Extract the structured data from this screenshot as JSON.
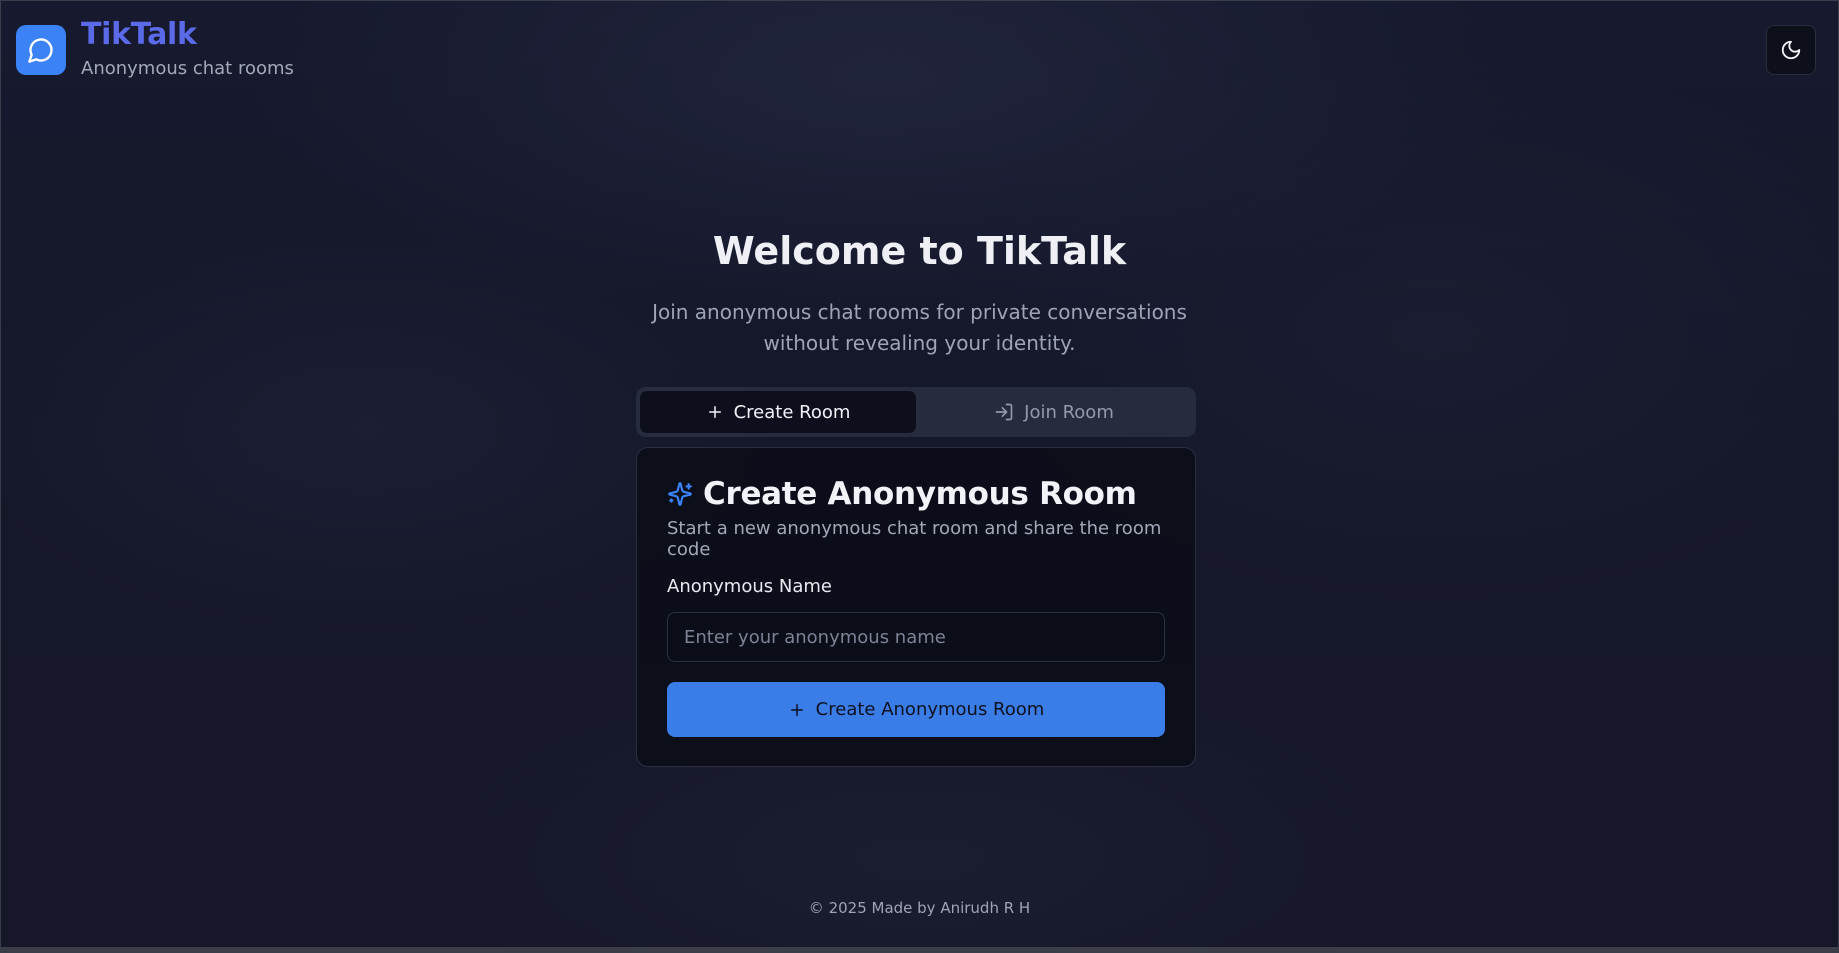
{
  "header": {
    "brand_title": "TikTalk",
    "brand_subtitle": "Anonymous chat rooms",
    "logo_icon": "message-circle-icon",
    "theme_toggle_icon": "moon-icon"
  },
  "hero": {
    "title": "Welcome to TikTalk",
    "subtitle": "Join anonymous chat rooms for private conversations without revealing your identity."
  },
  "tabs": [
    {
      "label": "Create Room",
      "icon": "plus-icon",
      "active": true
    },
    {
      "label": "Join Room",
      "icon": "log-in-icon",
      "active": false
    }
  ],
  "card": {
    "icon": "sparkles-icon",
    "title": "Create Anonymous Room",
    "description": "Start a new anonymous chat room and share the room code",
    "field_label": "Anonymous Name",
    "input_placeholder": "Enter your anonymous name",
    "input_value": "",
    "button_label": "Create Anonymous Room",
    "button_icon": "plus-icon"
  },
  "footer": {
    "text": "© 2025 Made by Anirudh R H"
  },
  "colors": {
    "accent": "#3b82f6",
    "brand_text": "#5b6ae8",
    "background": "#161829"
  }
}
